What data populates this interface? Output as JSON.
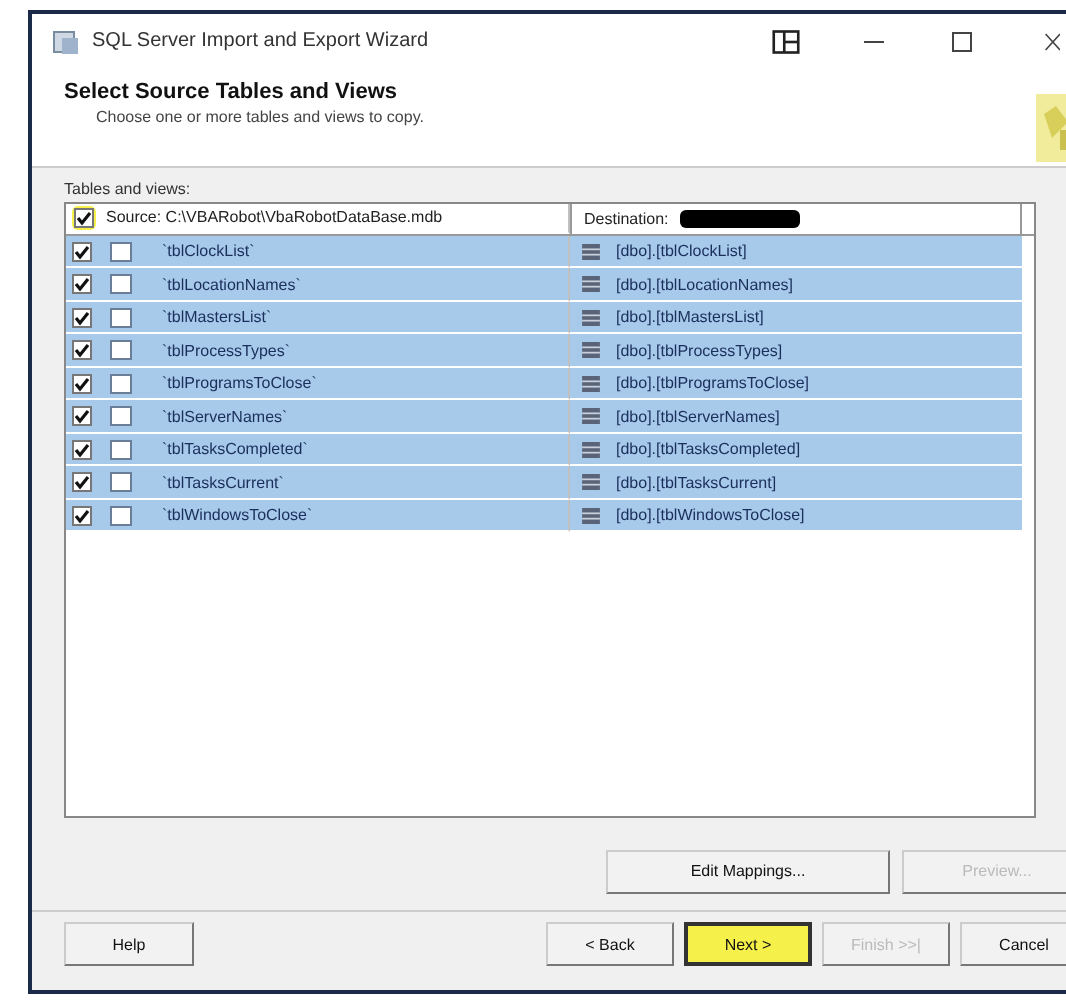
{
  "window": {
    "title": "SQL Server Import and Export Wizard"
  },
  "header": {
    "title": "Select Source Tables and Views",
    "subtitle": "Choose one or more tables and views to copy."
  },
  "grid": {
    "label": "Tables and views:",
    "source_header": {
      "text": "Source: C:\\VBARobot\\VbaRobotDataBase.mdb",
      "checked": true,
      "highlighted": true
    },
    "destination_header": {
      "text": "Destination:",
      "redacted": true
    },
    "rows": [
      {
        "source": "`tblClockList`",
        "destination": "[dbo].[tblClockList]",
        "checked": true,
        "selected": true
      },
      {
        "source": "`tblLocationNames`",
        "destination": "[dbo].[tblLocationNames]",
        "checked": true,
        "selected": true
      },
      {
        "source": "`tblMastersList`",
        "destination": "[dbo].[tblMastersList]",
        "checked": true,
        "selected": true
      },
      {
        "source": "`tblProcessTypes`",
        "destination": "[dbo].[tblProcessTypes]",
        "checked": true,
        "selected": true
      },
      {
        "source": "`tblProgramsToClose`",
        "destination": "[dbo].[tblProgramsToClose]",
        "checked": true,
        "selected": true
      },
      {
        "source": "`tblServerNames`",
        "destination": "[dbo].[tblServerNames]",
        "checked": true,
        "selected": true
      },
      {
        "source": "`tblTasksCompleted`",
        "destination": "[dbo].[tblTasksCompleted]",
        "checked": true,
        "selected": true
      },
      {
        "source": "`tblTasksCurrent`",
        "destination": "[dbo].[tblTasksCurrent]",
        "checked": true,
        "selected": true
      },
      {
        "source": "`tblWindowsToClose`",
        "destination": "[dbo].[tblWindowsToClose]",
        "checked": true,
        "selected": true
      }
    ]
  },
  "mapping_buttons": [
    {
      "label": "Edit Mappings...",
      "disabled": false
    },
    {
      "label": "Preview...",
      "disabled": true
    }
  ],
  "footer": {
    "help": {
      "label": "Help",
      "disabled": false
    },
    "nav": [
      {
        "label": "< Back",
        "disabled": false,
        "highlighted": false
      },
      {
        "label": "Next >",
        "disabled": false,
        "highlighted": true
      },
      {
        "label": "Finish >>|",
        "disabled": true,
        "highlighted": false
      },
      {
        "label": "Cancel",
        "disabled": false,
        "highlighted": false
      }
    ]
  }
}
